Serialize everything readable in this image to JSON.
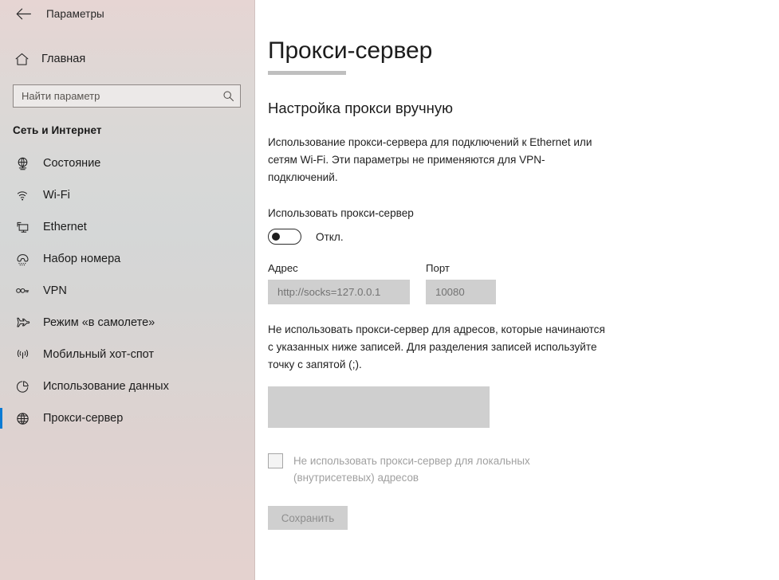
{
  "window": {
    "back_label": "Назад",
    "title": "Параметры"
  },
  "sidebar": {
    "home": {
      "label": "Главная",
      "icon": "home-icon"
    },
    "search": {
      "placeholder": "Найти параметр",
      "value": "",
      "icon": "search-icon"
    },
    "section_title": "Сеть и Интернет",
    "accent_color": "#0b7bd4",
    "items": [
      {
        "label": "Состояние",
        "icon": "status-globe-icon",
        "selected": false
      },
      {
        "label": "Wi-Fi",
        "icon": "wifi-icon",
        "selected": false
      },
      {
        "label": "Ethernet",
        "icon": "ethernet-icon",
        "selected": false
      },
      {
        "label": "Набор номера",
        "icon": "dialup-phone-icon",
        "selected": false
      },
      {
        "label": "VPN",
        "icon": "vpn-icon",
        "selected": false
      },
      {
        "label": "Режим «в самолете»",
        "icon": "airplane-icon",
        "selected": false
      },
      {
        "label": "Мобильный хот-спот",
        "icon": "hotspot-icon",
        "selected": false
      },
      {
        "label": "Использование данных",
        "icon": "pie-chart-icon",
        "selected": false
      },
      {
        "label": "Прокси-сервер",
        "icon": "globe-icon",
        "selected": true
      }
    ]
  },
  "main": {
    "page_title": "Прокси-сервер",
    "section_heading": "Настройка прокси вручную",
    "description": "Использование прокси-сервера для подключений к Ethernet или сетям Wi-Fi. Эти параметры не применяются для VPN-подключений.",
    "use_proxy_label": "Использовать прокси-сервер",
    "toggle": {
      "state_label": "Откл.",
      "on": false
    },
    "address": {
      "label": "Адрес",
      "value": "http://socks=127.0.0.1",
      "disabled": true
    },
    "port": {
      "label": "Порт",
      "value": "10080",
      "disabled": true
    },
    "exceptions_description": "Не использовать прокси-сервер для адресов, которые начинаются с указанных ниже записей. Для разделения записей используйте точку с запятой (;).",
    "exceptions": {
      "value": "",
      "disabled": true
    },
    "bypass_local": {
      "label": "Не использовать прокси-сервер для локальных (внутрисетевых) адресов",
      "checked": false,
      "disabled": true
    },
    "save_button": {
      "label": "Сохранить",
      "disabled": true
    }
  }
}
